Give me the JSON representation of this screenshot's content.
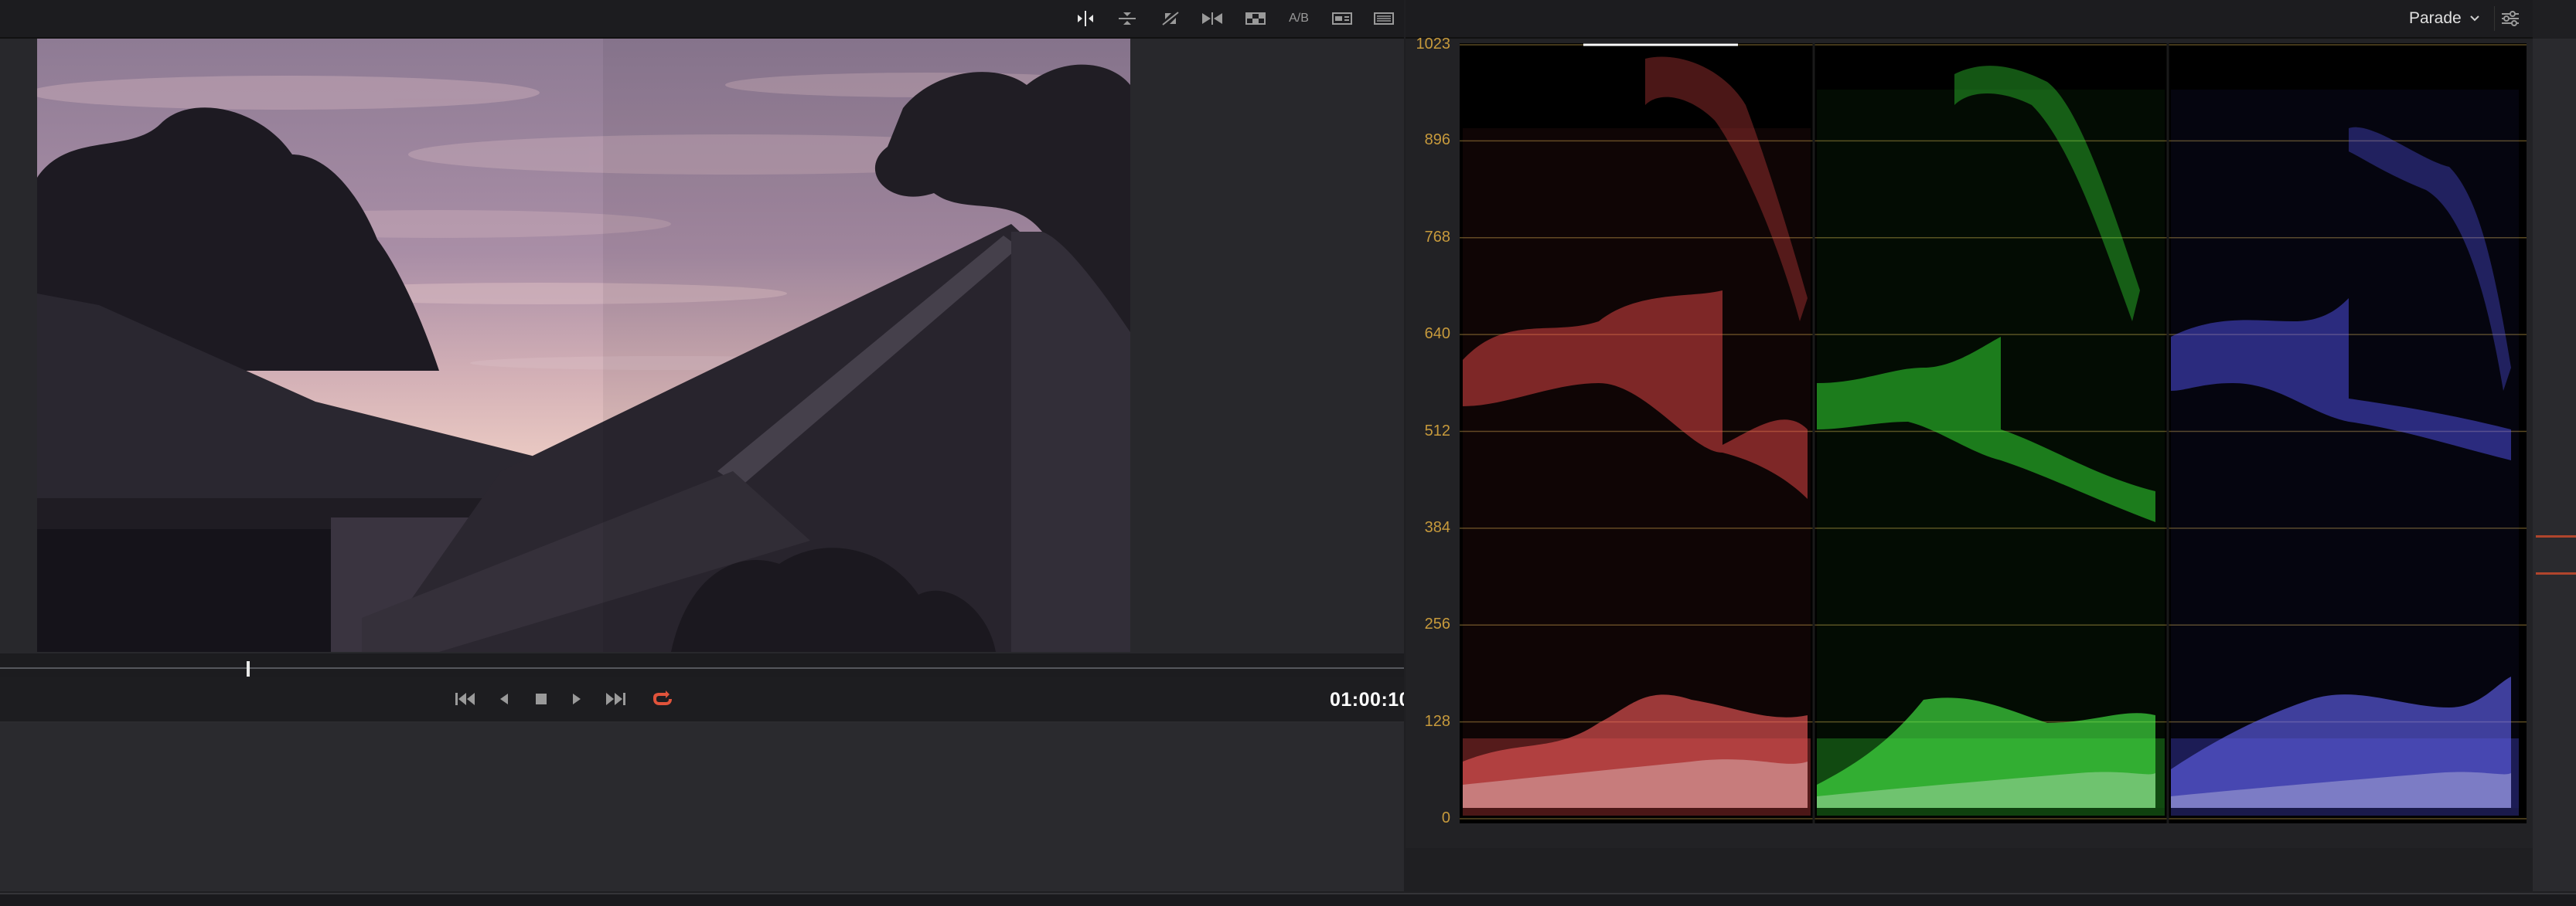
{
  "viewer": {
    "toolbar": {
      "icons": [
        "split-wipe-icon",
        "vertical-split-icon",
        "mirror-wipe-icon",
        "side-by-side-icon",
        "checker-icon",
        "ab-icon",
        "dual-view-icon",
        "display-options-icon"
      ],
      "ab_label": "A/B"
    }
  },
  "transport": {
    "timecode": "01:00:10:",
    "buttons": [
      "first-frame-icon",
      "reverse-play-icon",
      "stop-icon",
      "play-icon",
      "last-frame-icon",
      "loop-icon"
    ],
    "loop_color": "#e0533b"
  },
  "scopes": {
    "mode": "Parade",
    "scale_labels": [
      "1023",
      "896",
      "768",
      "640",
      "512",
      "384",
      "256",
      "128",
      "0"
    ],
    "scale_color": "#c79a3c",
    "channel_colors": {
      "red": "#ff5050",
      "green": "#3cff3c",
      "blue": "#5a5aff"
    }
  }
}
